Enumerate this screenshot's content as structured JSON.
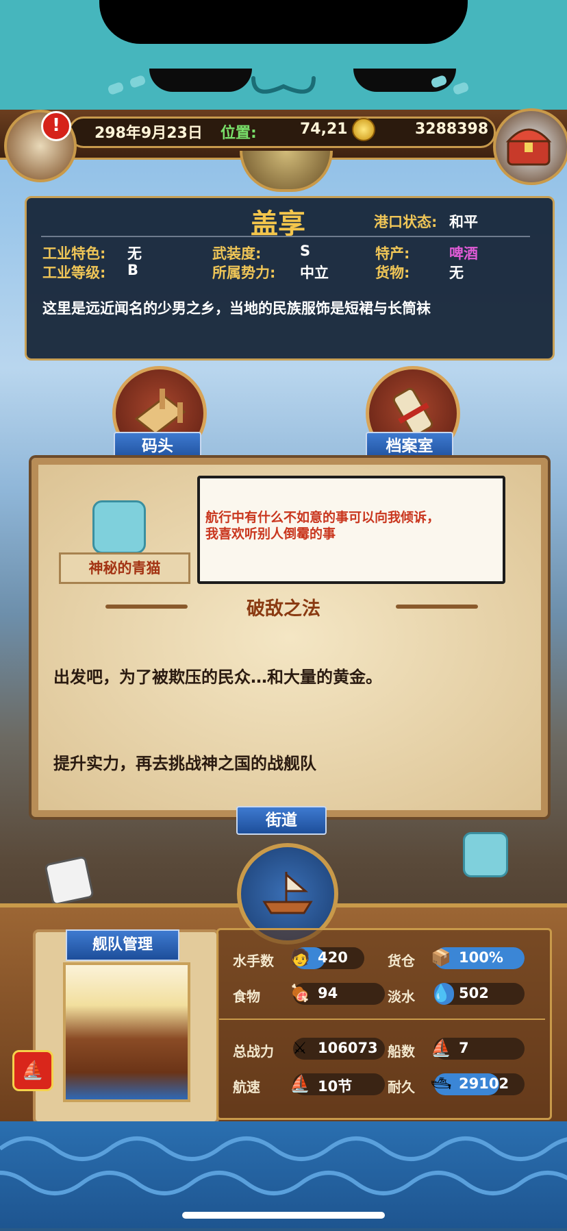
{
  "top_bar": {
    "date": "298年9月23日",
    "position_label": "位置:",
    "position_value": "74,21",
    "gold": "3288398",
    "alert_glyph": "!"
  },
  "port": {
    "name": "盖享",
    "status_label": "港口状态:",
    "status_value": "和平",
    "fields": [
      {
        "label": "工业特色:",
        "value": "无"
      },
      {
        "label": "武装度:",
        "value": "S"
      },
      {
        "label": "特产:",
        "value": "啤酒"
      },
      {
        "label": "工业等级:",
        "value": "B"
      },
      {
        "label": "所属势力:",
        "value": "中立"
      },
      {
        "label": "货物:",
        "value": "无"
      }
    ],
    "specialty_color": "#e05bd6",
    "description": "这里是远近闻名的少男之乡，当地的民族服饰是短裙与长筒袜"
  },
  "buildings": {
    "dock": "码头",
    "archive": "档案室",
    "street": "街道"
  },
  "dialog": {
    "speaker": "神秘的青猫",
    "speech": [
      "航行中有什么不如意的事可以向我倾诉，",
      "我喜欢听别人倒霉的事"
    ],
    "speech_color": "#c9361e",
    "quest_title": "破敌之法",
    "lines": [
      "出发吧，为了被欺压的民众…和大量的黄金。",
      "提升实力，再去挑战神之国的战舰队"
    ]
  },
  "fleet": {
    "title": "舰队管理",
    "stats": [
      {
        "label": "水手数",
        "icon": "sailor-icon",
        "value": "420",
        "fill": 0.45
      },
      {
        "label": "货仓",
        "icon": "crate-icon",
        "value": "100%",
        "fill": 1.0
      },
      {
        "label": "食物",
        "icon": "meat-icon",
        "value": "94",
        "fill": 0.0
      },
      {
        "label": "淡水",
        "icon": "water-icon",
        "value": "502",
        "fill": 0.22
      },
      {
        "label": "总战力",
        "icon": "swords-icon",
        "value": "106073",
        "fill": 0.0
      },
      {
        "label": "船数",
        "icon": "boat-icon",
        "value": "7",
        "fill": 0.0
      },
      {
        "label": "航速",
        "icon": "sail-icon",
        "value": "10节",
        "fill": 0.0
      },
      {
        "label": "耐久",
        "icon": "hull-icon",
        "value": "29102",
        "fill": 0.72
      }
    ]
  },
  "colors": {
    "accent_gold": "#f0c657",
    "bar_blue": "#3b86d6",
    "cat_teal": "#46b6bd"
  }
}
